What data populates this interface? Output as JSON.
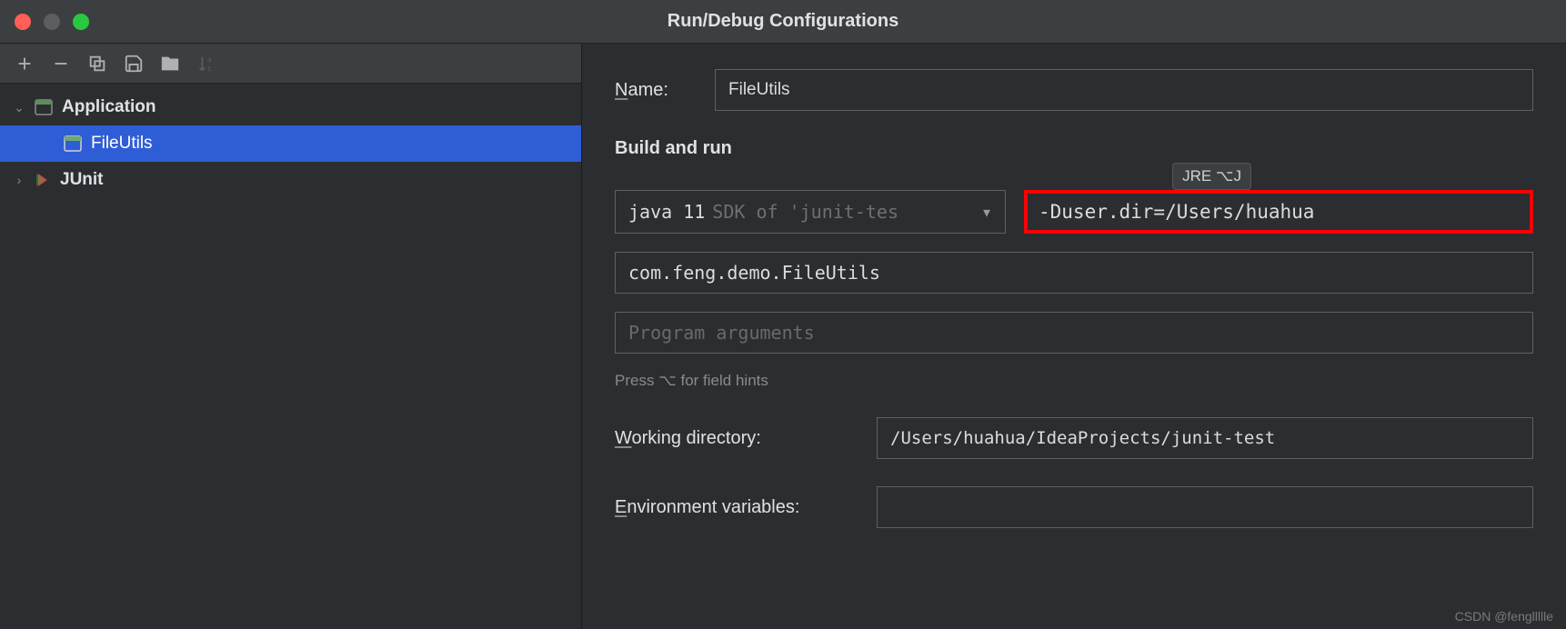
{
  "window": {
    "title": "Run/Debug Configurations"
  },
  "tree": {
    "application": {
      "label": "Application"
    },
    "fileutils": {
      "label": "FileUtils"
    },
    "junit": {
      "label": "JUnit"
    }
  },
  "form": {
    "name_label": "Name:",
    "name_value": "FileUtils",
    "section_build": "Build and run",
    "jre_hint": "JRE ⌥J",
    "sdk_bold": "java 11",
    "sdk_dim": "SDK of 'junit-tes",
    "vm_options": "-Duser.dir=/Users/huahua",
    "main_class": "com.feng.demo.FileUtils",
    "program_args_placeholder": "Program arguments",
    "hint": "Press ⌥ for field hints",
    "working_dir_label": "Working directory:",
    "working_dir_value": "/Users/huahua/IdeaProjects/junit-test",
    "env_label": "Environment variables:",
    "env_value": ""
  },
  "watermark": "CSDN @fengllllle"
}
